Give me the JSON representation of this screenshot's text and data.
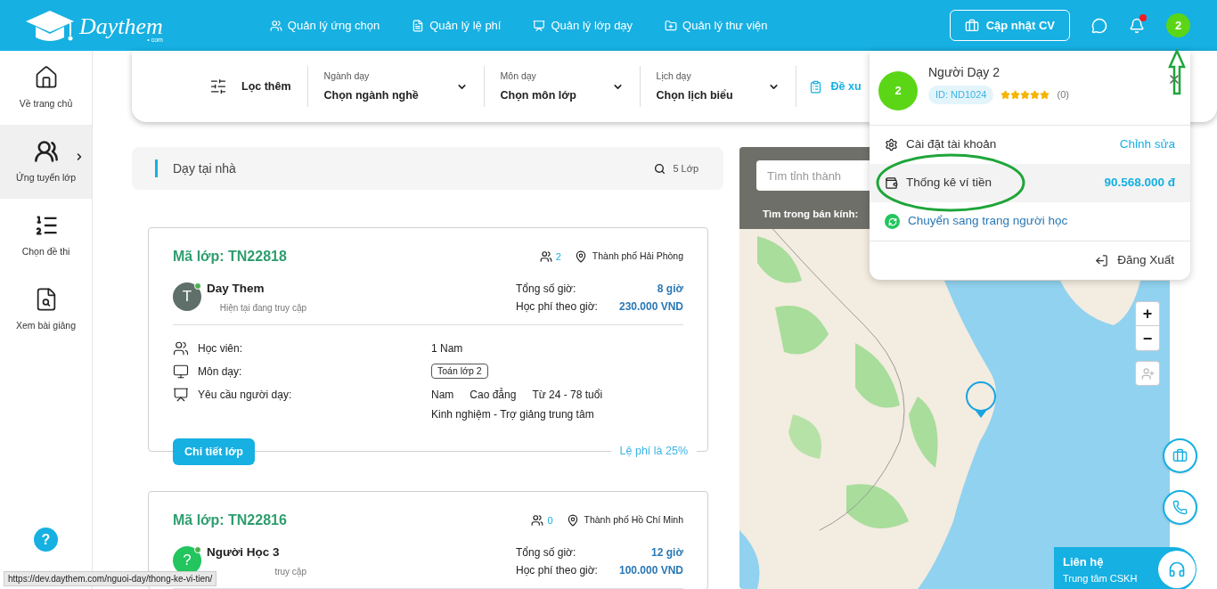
{
  "header": {
    "logo": "Daythem",
    "logo_sub": "• com",
    "nav": [
      {
        "label": "Quản lý ứng chọn"
      },
      {
        "label": "Quản lý lệ phí"
      },
      {
        "label": "Quản lý lớp dạy"
      },
      {
        "label": "Quản lý thư viện"
      }
    ],
    "cv_button": "Cập nhật CV",
    "notification_unread": true,
    "avatar": "2"
  },
  "sidebar": {
    "items": [
      {
        "label": "Về trang chủ",
        "selected": false
      },
      {
        "label": "Ứng tuyển lớp",
        "selected": true
      },
      {
        "label": "Chọn đề thi",
        "selected": false
      },
      {
        "label": "Xem bài giảng",
        "selected": false
      }
    ],
    "help": "?"
  },
  "filter": {
    "more": "Lọc thêm",
    "dropdowns": [
      {
        "label": "Ngành dạy",
        "value": "Chọn ngành nghề"
      },
      {
        "label": "Môn dạy",
        "value": "Chọn môn lớp"
      },
      {
        "label": "Lịch dạy",
        "value": "Chọn lịch biểu"
      }
    ],
    "suggest": "Đề xu"
  },
  "list": {
    "title": "Dạy tại nhà",
    "count": "5 Lớp"
  },
  "classes": [
    {
      "code": "Mã lớp: TN22818",
      "applicants": "2",
      "city": "Thành phố Hải Phòng",
      "name": "Day Them",
      "avatar": "T",
      "color": "#5f6f6a",
      "status": "Hiện tại đang truy cập",
      "online": true,
      "hours_label": "Tổng số giờ:",
      "hours": "8 giờ",
      "fee_label": "Học phí theo giờ:",
      "fee": "230.000 VND",
      "details": [
        {
          "kind": "text",
          "label": "Học viên:",
          "values": [
            "1 Nam"
          ]
        },
        {
          "kind": "tag",
          "label": "Môn dạy:",
          "values": [
            "Toán lớp 2"
          ]
        },
        {
          "kind": "text",
          "label": "Yêu cầu người dạy:",
          "values": [
            "Nam",
            "Cao đẳng",
            "Từ 24 - 78 tuổi"
          ],
          "note": "Kinh nghiệm - Trợ giảng trung tâm"
        }
      ],
      "button": "Chi tiết lớp",
      "commission": "Lệ phí là 25%"
    },
    {
      "code": "Mã lớp: TN22816",
      "applicants": "0",
      "city": "Thành phố Hồ Chí Minh",
      "name": "Người Học 3",
      "avatar": "?",
      "color": "#22c55e",
      "status": "truy cập",
      "online": true,
      "hours_label": "Tổng số giờ:",
      "hours": "12 giờ",
      "fee_label": "Học phí theo giờ:",
      "fee": "100.000 VND"
    }
  ],
  "map": {
    "search_placeholder": "Tìm tỉnh thành",
    "radius_label": "Tìm trong bán kính:",
    "zoom_in": "+",
    "zoom_out": "−"
  },
  "account_menu": {
    "avatar": "2",
    "name": "Người Dạy 2",
    "id": "ID: ND1024",
    "stars": 5,
    "reviews": "(0)",
    "items": [
      {
        "kind": "settings",
        "label": "Cài đặt tài khoản",
        "action": "Chỉnh sửa",
        "selected": false
      },
      {
        "kind": "wallet",
        "label": "Thống kê ví tiền",
        "action": "90.568.000 đ",
        "selected": true
      },
      {
        "kind": "switch",
        "label": "Chuyển sang trang người học",
        "selected": false
      }
    ],
    "logout": "Đăng Xuất"
  },
  "contact": {
    "title": "Liên hệ",
    "subtitle": "Trung tâm CSKH"
  },
  "status_url": "https://dev.daythem.com/nguoi-day/thong-ke-vi-tien/"
}
